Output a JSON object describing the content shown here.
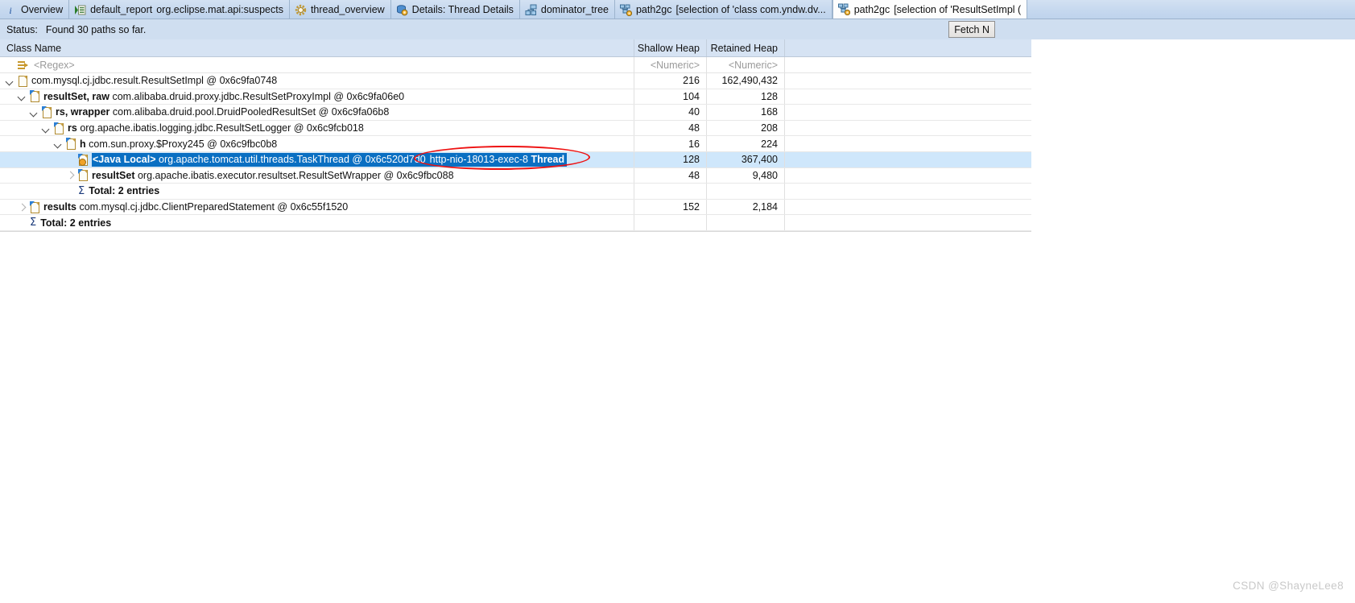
{
  "window": {
    "watermark": "CSDN @ShayneLee8"
  },
  "tabs": [
    {
      "icon": "info-icon",
      "label": "Overview",
      "sublabel": "",
      "active": false
    },
    {
      "icon": "report-icon",
      "label": "default_report",
      "sublabel": "org.eclipse.mat.api:suspects",
      "active": false
    },
    {
      "icon": "thread-overview-icon",
      "label": "thread_overview",
      "sublabel": "",
      "active": false
    },
    {
      "icon": "details-icon",
      "label": "Details: Thread Details",
      "sublabel": "",
      "active": false
    },
    {
      "icon": "dominator-tree-icon",
      "label": "dominator_tree",
      "sublabel": "",
      "active": false
    },
    {
      "icon": "path2gc-icon",
      "label": "path2gc",
      "sublabel": "[selection of 'class com.yndw.dv...",
      "active": false
    },
    {
      "icon": "path2gc-icon",
      "label": "path2gc",
      "sublabel": "[selection of 'ResultSetImpl (",
      "active": true
    }
  ],
  "status": {
    "label": "Status:",
    "text": "Found 30 paths so far."
  },
  "toolbar": {
    "fetch_label": "Fetch N"
  },
  "table": {
    "columns": [
      "Class Name",
      "Shallow Heap",
      "Retained Heap",
      ""
    ],
    "filters": [
      "<Regex>",
      "<Numeric>",
      "<Numeric>",
      ""
    ],
    "rows": [
      {
        "indent": 0,
        "twisty": "open",
        "icon": "object-icon",
        "gcflag": false,
        "field": "",
        "text": "com.mysql.cj.jdbc.result.ResultSetImpl @ 0x6c9fa0748",
        "shallow": "216",
        "retained": "162,490,432",
        "selected": false,
        "kind": "object"
      },
      {
        "indent": 1,
        "twisty": "open",
        "icon": "object-icon",
        "gcflag": true,
        "field": "resultSet, raw",
        "text": "com.alibaba.druid.proxy.jdbc.ResultSetProxyImpl @ 0x6c9fa06e0",
        "shallow": "104",
        "retained": "128",
        "selected": false,
        "kind": "object"
      },
      {
        "indent": 2,
        "twisty": "open",
        "icon": "object-icon",
        "gcflag": true,
        "field": "rs, wrapper",
        "text": "com.alibaba.druid.pool.DruidPooledResultSet @ 0x6c9fa06b8",
        "shallow": "40",
        "retained": "168",
        "selected": false,
        "kind": "object"
      },
      {
        "indent": 3,
        "twisty": "open",
        "icon": "object-icon",
        "gcflag": true,
        "field": "rs",
        "text": "org.apache.ibatis.logging.jdbc.ResultSetLogger @ 0x6c9fcb018",
        "shallow": "48",
        "retained": "208",
        "selected": false,
        "kind": "object"
      },
      {
        "indent": 4,
        "twisty": "open",
        "icon": "object-icon",
        "gcflag": true,
        "field": "h",
        "text": "com.sun.proxy.$Proxy245 @ 0x6c9fbc0b8",
        "shallow": "16",
        "retained": "224",
        "selected": false,
        "kind": "object"
      },
      {
        "indent": 5,
        "twisty": "none",
        "icon": "java-local-icon",
        "gcflag": true,
        "field": "<Java Local>",
        "text": "org.apache.tomcat.util.threads.TaskThread @ 0x6c520d7d0",
        "thread": "http-nio-18013-exec-8",
        "thread_suffix": "Thread",
        "shallow": "128",
        "retained": "367,400",
        "selected": true,
        "kind": "java-local"
      },
      {
        "indent": 5,
        "twisty": "closed",
        "icon": "object-icon",
        "gcflag": true,
        "field": "resultSet",
        "text": "org.apache.ibatis.executor.resultset.ResultSetWrapper @ 0x6c9fbc088",
        "shallow": "48",
        "retained": "9,480",
        "selected": false,
        "kind": "object"
      },
      {
        "indent": 5,
        "twisty": "none",
        "icon": "sigma-icon",
        "gcflag": false,
        "field": "",
        "text": "Total: 2 entries",
        "shallow": "",
        "retained": "",
        "selected": false,
        "kind": "total"
      },
      {
        "indent": 1,
        "twisty": "closed",
        "icon": "object-icon",
        "gcflag": true,
        "field": "results",
        "text": "com.mysql.cj.jdbc.ClientPreparedStatement @ 0x6c55f1520",
        "shallow": "152",
        "retained": "2,184",
        "selected": false,
        "kind": "object"
      },
      {
        "indent": 1,
        "twisty": "none",
        "icon": "sigma-icon",
        "gcflag": false,
        "field": "",
        "text": "Total: 2 entries",
        "shallow": "",
        "retained": "",
        "selected": false,
        "kind": "total"
      }
    ]
  },
  "annotation": {
    "shape": "red-ellipse",
    "color": "#ee1111",
    "target": "http-nio-18013-exec-8 Thread"
  }
}
